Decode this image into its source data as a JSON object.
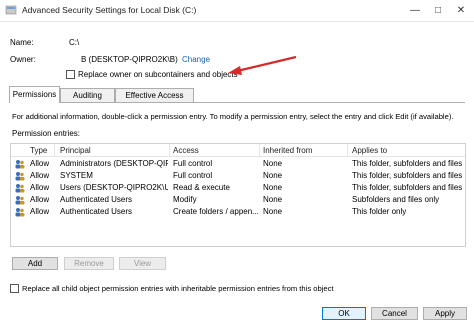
{
  "window": {
    "title": "Advanced Security Settings for Local Disk (C:)",
    "minimize": "—",
    "maximize": "□",
    "close": "✕"
  },
  "info": {
    "name_label": "Name:",
    "name_value": "C:\\",
    "owner_label": "Owner:",
    "owner_value": "B (DESKTOP-QIPRO2K\\B)",
    "change_link": "Change",
    "replace_owner_label": "Replace owner on subcontainers and objects"
  },
  "tabs": [
    {
      "label": "Permissions",
      "active": true
    },
    {
      "label": "Auditing",
      "active": false
    },
    {
      "label": "Effective Access",
      "active": false
    }
  ],
  "instructions": "For additional information, double-click a permission entry. To modify a permission entry, select the entry and click Edit (if available).",
  "entries_label": "Permission entries:",
  "table": {
    "columns": [
      "Type",
      "Principal",
      "Access",
      "Inherited from",
      "Applies to"
    ],
    "rows": [
      {
        "type": "Allow",
        "principal": "Administrators (DESKTOP-QIP...",
        "access": "Full control",
        "inherited": "None",
        "applies": "This folder, subfolders and files"
      },
      {
        "type": "Allow",
        "principal": "SYSTEM",
        "access": "Full control",
        "inherited": "None",
        "applies": "This folder, subfolders and files"
      },
      {
        "type": "Allow",
        "principal": "Users (DESKTOP-QIPRO2K\\Us...",
        "access": "Read & execute",
        "inherited": "None",
        "applies": "This folder, subfolders and files"
      },
      {
        "type": "Allow",
        "principal": "Authenticated Users",
        "access": "Modify",
        "inherited": "None",
        "applies": "Subfolders and files only"
      },
      {
        "type": "Allow",
        "principal": "Authenticated Users",
        "access": "Create folders / appen...",
        "inherited": "None",
        "applies": "This folder only"
      }
    ]
  },
  "buttons": {
    "add": "Add",
    "remove": "Remove",
    "view": "View",
    "ok": "OK",
    "cancel": "Cancel",
    "apply": "Apply"
  },
  "replace_child_label": "Replace all child object permission entries with inheritable permission entries from this object",
  "colors": {
    "link": "#1a5fb4",
    "arrow": "#d42a2a",
    "accent": "#0078d7"
  }
}
